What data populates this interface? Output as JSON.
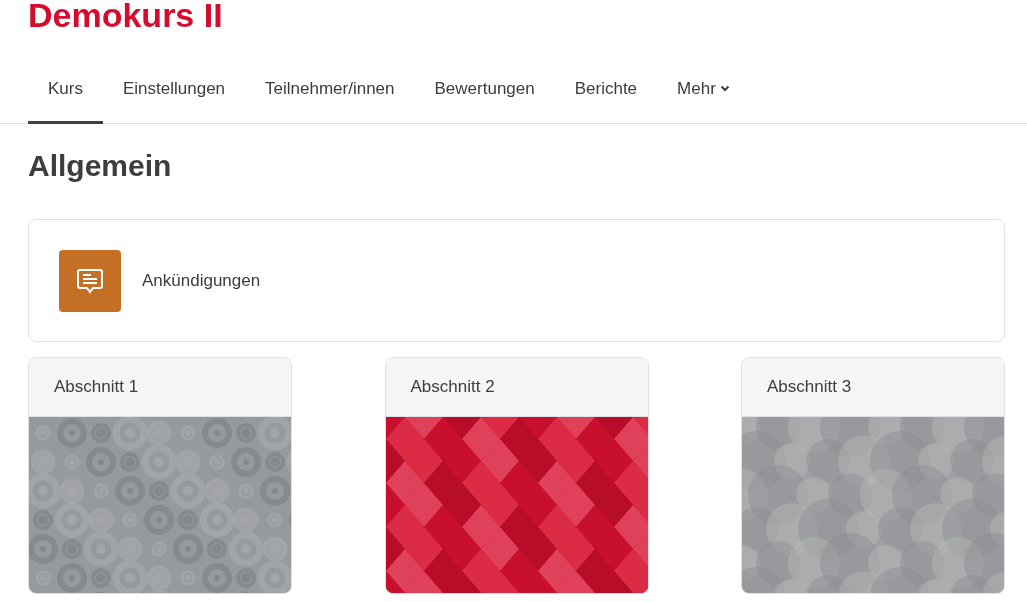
{
  "course_title": "Demokurs II",
  "tabs": [
    {
      "label": "Kurs",
      "selected": true
    },
    {
      "label": "Einstellungen",
      "selected": false
    },
    {
      "label": "Teilnehmer/innen",
      "selected": false
    },
    {
      "label": "Bewertungen",
      "selected": false
    },
    {
      "label": "Berichte",
      "selected": false
    },
    {
      "label": "Mehr",
      "selected": false,
      "dropdown": true
    }
  ],
  "section_heading": "Allgemein",
  "activity": {
    "label": "Ankündigungen"
  },
  "sections": [
    {
      "title": "Abschnitt 1",
      "kind": "rings"
    },
    {
      "title": "Abschnitt 2",
      "kind": "diamonds"
    },
    {
      "title": "Abschnitt 3",
      "kind": "bubbles"
    }
  ]
}
